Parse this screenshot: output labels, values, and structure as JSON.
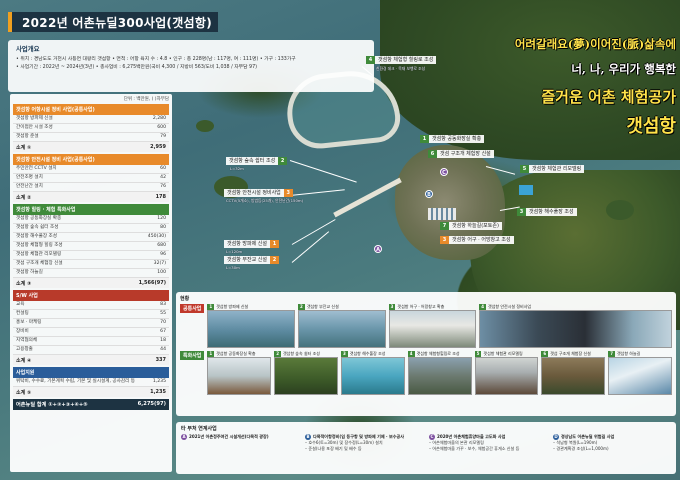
{
  "header": {
    "title": "2022년 어촌뉴딜300사업(갯섬항)"
  },
  "overview": {
    "title": "사업개요",
    "lines": [
      "• 위치 : 경남도도 거천시 사등면 대왕리 갯섬항   • 면적 : 어항 육지 수 : 4.8    • 인구 : 총 228명(남 : 117명, 여 : 111명)    • 가구 : 133가구",
      "• 사업기간 : 2022년 ~ 2024년(3년)   • 총사업비 : 6,275백만원(국비 4,300 / 지방비 563/도비 1,038 / 자부담 97)"
    ]
  },
  "slogan": {
    "line1": "어려갈래요(夢)이어진(脈)삶속에",
    "line2": "너, 나, 우리가 행복한",
    "line3": "즐거운 어촌 체험공가",
    "line4": "갯섬항"
  },
  "budget": {
    "unit": "단위 : 백만원, ( )자부담",
    "sections": [
      {
        "title": "갯섬항 어항시설 정비 사업(공통사업)",
        "color": "orange",
        "rows": [
          [
            "갯섬항 방파제 신설",
            "2,280"
          ],
          [
            "간이접안 시설 조성",
            "600"
          ],
          [
            "갯섬항 준설",
            "79"
          ]
        ],
        "subtotal": [
          "소계 ①",
          "2,959"
        ]
      },
      {
        "title": "갯섬항 안전시설 정비 사업(공통사업)",
        "color": "orange",
        "rows": [
          [
            "주민안전 CCTV 설치",
            "60"
          ],
          [
            "안전조명 설치",
            "42"
          ],
          [
            "안전난간 설치",
            "76"
          ]
        ],
        "subtotal": [
          "소계 ②",
          "178"
        ]
      },
      {
        "title": "갯섬항 힐링 · 체험 특화사업",
        "color": "green",
        "rows": [
          [
            "갯섬항 공동화장실 확충",
            "120"
          ],
          [
            "갯섬항 숲속 쉼터 조성",
            "80"
          ],
          [
            "갯섬항 해수풀장 조성",
            "450(30)"
          ],
          [
            "갯섬항 체험형 힐링 조성",
            "680"
          ],
          [
            "갯섬항 체험관 리모델링",
            "96"
          ],
          [
            "갯섬 구조개 체험장 신설",
            "32(7)"
          ],
          [
            "갯섬항 하늘길",
            "100"
          ]
        ],
        "subtotal": [
          "소계 ③",
          "1,566(97)"
        ]
      },
      {
        "title": "S/W 사업",
        "color": "red",
        "rows": [
          [
            "교육",
            "83"
          ],
          [
            "컨설팅",
            "55"
          ],
          [
            "홍보 · 마케팅",
            "70"
          ],
          [
            "장비비",
            "67"
          ],
          [
            "지역협의체",
            "18"
          ],
          [
            "고용창출",
            "44"
          ]
        ],
        "subtotal": [
          "소계 ④",
          "337"
        ]
      },
      {
        "title": "사업지원",
        "color": "blue",
        "rows": [
          [
            "위탁비, 수수료, 기본계획 수립, 기본 및 실시설계, 공사감리 등",
            "1,235"
          ]
        ],
        "subtotal": [
          "소계 ⑤",
          "1,235"
        ]
      }
    ],
    "total": [
      "어촌뉴딜 합계 ①+②+③+④+⑤",
      "6,275(97)"
    ]
  },
  "map_labels": [
    {
      "num": "4",
      "text": "갯섬항 체험형 힐링로 조성",
      "kind": "g"
    },
    {
      "num": "1",
      "text": "갯섬항 공동화장실 확충",
      "kind": "g"
    },
    {
      "num": "6",
      "text": "갯섬 구조개 체험장 신설",
      "kind": "g"
    },
    {
      "num": "2",
      "text": "갯섬항 숲속 쉼터 조성",
      "kind": "g"
    },
    {
      "num": "3",
      "text": "갯섬항 안전시설 정비사업",
      "kind": "o"
    },
    {
      "num": "5",
      "text": "갯섬항 체험관 리모델링",
      "kind": "g"
    },
    {
      "num": "3",
      "text": "갯섬항 해수풀장 조성",
      "kind": "g"
    },
    {
      "num": "7",
      "text": "갯섬항 하늘길(포토존)",
      "kind": "g"
    },
    {
      "num": "1",
      "text": "갯섬항 방파제 신설",
      "kind": "o"
    },
    {
      "num": "3",
      "text": "갯섬항 어구 · 어망창고 조성",
      "kind": "o"
    },
    {
      "num": "2",
      "text": "갯섬항 부잔교 신설",
      "kind": "o"
    }
  ],
  "map_notes": {
    "n1": "친환경 데크 · 목재 보행로 조성",
    "n2": "CCTV(5개소), 방범등(25개), 안전난간(150m)",
    "n3": "L=32m",
    "n4": "L=120m",
    "n5": "L=30m"
  },
  "photos": {
    "title": "현황",
    "group1_tag": "공통사업",
    "group1": [
      {
        "num": "1",
        "cap": "갯섬항 방파제 신설"
      },
      {
        "num": "2",
        "cap": "갯섬항 부잔교 신설"
      },
      {
        "num": "3",
        "cap": "갯섬항 어구 · 어망창고 확충"
      },
      {
        "num": "4",
        "cap": "갯섬항 안전시설 정비사업"
      }
    ],
    "group2_tag": "특화사업",
    "group2": [
      {
        "num": "1",
        "cap": "갯섬항 공동화장실 확충"
      },
      {
        "num": "2",
        "cap": "갯섬항 숲속 쉼터 조성"
      },
      {
        "num": "3",
        "cap": "갯섬항 해수풀장 조성"
      },
      {
        "num": "4",
        "cap": "갯섬항 체험형힐링로 조성"
      },
      {
        "num": "5",
        "cap": "갯섬항 체험관 리모델링"
      },
      {
        "num": "6",
        "cap": "갯섬 구조개 체험장 신설"
      },
      {
        "num": "7",
        "cap": "갯섬항 하늘길"
      }
    ]
  },
  "legend": {
    "title": "타 부처 연계사업",
    "cols": [
      {
        "badge": "A",
        "color": "#7c4fa0",
        "head": "2021년 어촌정주여건 시설개선(다목적 광장)",
        "lines": []
      },
      {
        "badge": "B",
        "color": "#2a5d9a",
        "head": "다목적어항정비(임 등구항 및 방파제 기제 · 보수공사",
        "lines": [
          "– 호수6(토=30m) 및 장수정(L=30m) 설치",
          "– 준설(나용 포장 배기 및 배수 등"
        ]
      },
      {
        "badge": "C",
        "color": "#7c4fa0",
        "head": "2020년 어촌체험휴양마을 고도화 사업",
        "lines": [
          "– 어촌체험마을의 본관 리모델링",
          "– 어촌체험마을 가꾸 · 보수, 체험공간 휴게소 신설 등"
        ]
      },
      {
        "badge": "D",
        "color": "#2a5d9a",
        "head": "경상남도 어촌뉴딜 위험길 사업",
        "lines": [
          "– 석남형 복원(L=190m)",
          "– 경관계획경 조성(L=1,000m)"
        ]
      }
    ]
  }
}
